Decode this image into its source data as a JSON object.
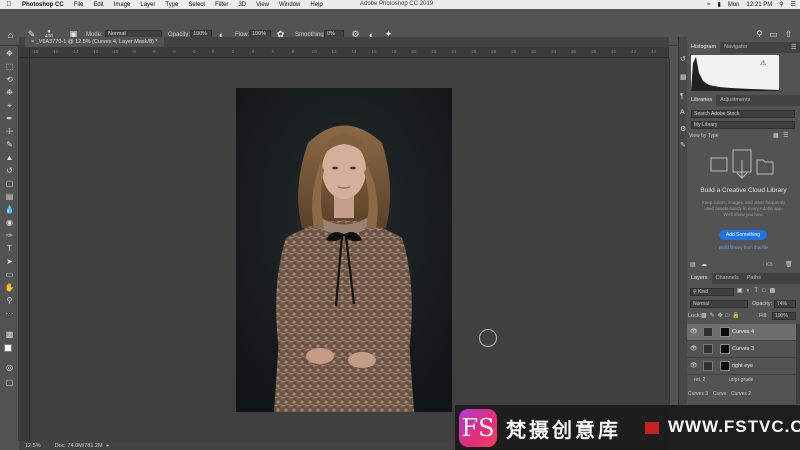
{
  "menubar": {
    "app": "Photoshop CC",
    "items": [
      "File",
      "Edit",
      "Image",
      "Layer",
      "Type",
      "Select",
      "Filter",
      "3D",
      "View",
      "Window",
      "Help"
    ],
    "window_title": "Adobe Photoshop CC 2019",
    "day": "Mon",
    "time": "12:21 PM"
  },
  "options": {
    "brush_size": "400",
    "mode_label": "Mode:",
    "mode_value": "Normal",
    "opacity_label": "Opacity:",
    "opacity_value": "100%",
    "flow_label": "Flow:",
    "flow_value": "100%",
    "smoothing_label": "Smoothing:",
    "smoothing_value": "0%"
  },
  "document": {
    "tab_title": "_V6A3770-1 @ 12.5% (Curves 4, Layer Mask/8) *"
  },
  "ruler_ticks": [
    "-18",
    "-16",
    "-14",
    "-12",
    "-10",
    "-8",
    "-6",
    "-4",
    "-2",
    "0",
    "2",
    "4",
    "6",
    "8",
    "10",
    "12",
    "14",
    "16",
    "18",
    "20",
    "22",
    "24",
    "26",
    "28",
    "30",
    "32",
    "34",
    "36",
    "38",
    "40",
    "42",
    "44"
  ],
  "status": {
    "zoom": "12.5%",
    "doc": "Doc: 74.0M/781.2M"
  },
  "panels": {
    "histogram_tabs": [
      "Histogram",
      "Navigator"
    ],
    "library_tabs": [
      "Libraries",
      "Adjustments"
    ],
    "library_search_placeholder": "Search Adobe Stock",
    "library_select": "My Library",
    "view_by": "View by Type",
    "cc_title": "Build a Creative Cloud Library",
    "cc_desc": "Keep colors, images, and other frequently used assets handy in every Adobe app. We'll show you how.",
    "cc_button": "Add Something",
    "cc_link": "Build library from this file",
    "library_size": "- KB",
    "layers_tabs": [
      "Layers",
      "Channels",
      "Paths"
    ],
    "kind_label": "Kind",
    "blend_mode": "Normal",
    "opacity_label": "Opacity:",
    "opacity_value": "74%",
    "lock_label": "Lock:",
    "fill_label": "Fill:",
    "fill_value": "100%",
    "layers": [
      {
        "name": "Curves 4",
        "selected": true
      },
      {
        "name": "Curves 3",
        "selected": false
      },
      {
        "name": "right eye",
        "selected": false
      }
    ],
    "overflow_row_1": "ret. 2",
    "overflow_row_1b": "ur/pr grade",
    "overflow_row_2a": "Curves 3",
    "overflow_row_2b": "Curve",
    "overflow_row_2c": "Curves 2"
  },
  "watermark": {
    "logo": "FS",
    "cn_text": "梵摄创意库",
    "url": "WWW.FSTVC.CC"
  },
  "colors": {
    "panel_bg": "#535353",
    "canvas_bg": "#404040",
    "accent_blue": "#1f73e8",
    "watermark_grad_start": "#b73bd8",
    "watermark_grad_end": "#ff3f5c"
  }
}
